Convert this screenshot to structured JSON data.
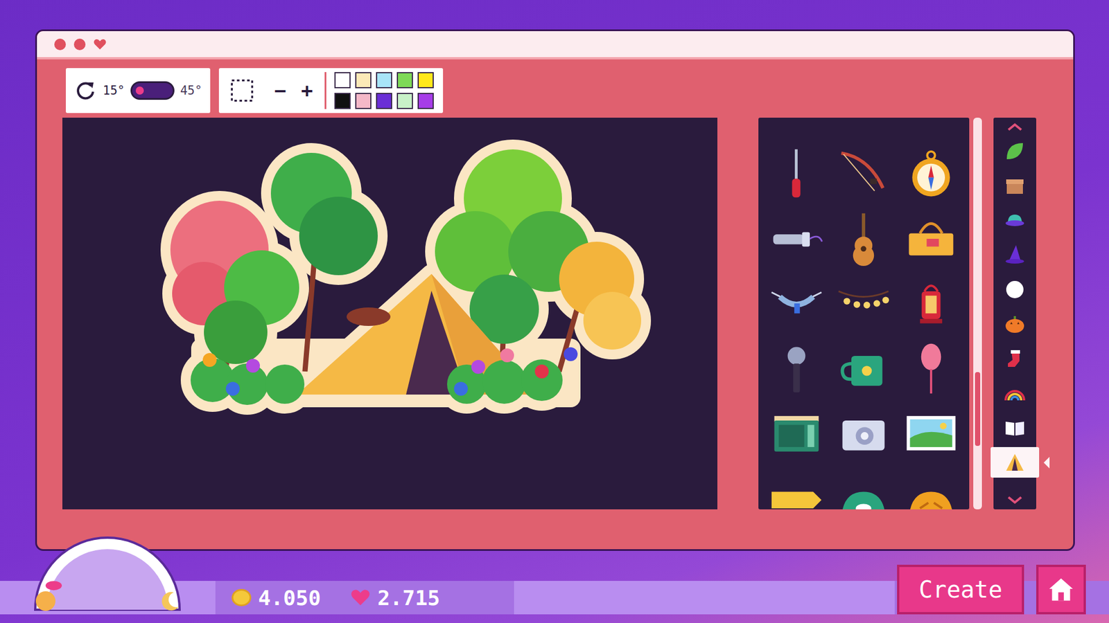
{
  "toolbar": {
    "rotation": [
      {
        "label": "15°",
        "selected": true
      },
      {
        "label": "45°",
        "selected": false
      }
    ],
    "zoom_out": "−",
    "zoom_in": "+",
    "palette": [
      {
        "color": "#ffffff"
      },
      {
        "color": "#fbe9b7"
      },
      {
        "color": "#a8e4f8"
      },
      {
        "color": "#7ed957"
      },
      {
        "color": "#ffe81a"
      },
      {
        "color": "#111111"
      },
      {
        "color": "#f4b8c8"
      },
      {
        "color": "#6a2fd6"
      },
      {
        "color": "#c8f2c8"
      },
      {
        "color": "#a63de8"
      }
    ]
  },
  "items": [
    {
      "kind": "screwdriver"
    },
    {
      "kind": "fishing-rod"
    },
    {
      "kind": "compass"
    },
    {
      "kind": "flashlight"
    },
    {
      "kind": "guitar"
    },
    {
      "kind": "basket"
    },
    {
      "kind": "hammock"
    },
    {
      "kind": "string-lights"
    },
    {
      "kind": "lantern"
    },
    {
      "kind": "microphone"
    },
    {
      "kind": "mug"
    },
    {
      "kind": "net"
    },
    {
      "kind": "radio"
    },
    {
      "kind": "camera"
    },
    {
      "kind": "photo"
    },
    {
      "kind": "sign"
    },
    {
      "kind": "dome"
    },
    {
      "kind": "pie"
    }
  ],
  "item_scroll": {
    "level": 0.8
  },
  "categories": [
    {
      "kind": "leaf",
      "selected": false
    },
    {
      "kind": "box",
      "selected": false
    },
    {
      "kind": "cap",
      "selected": false
    },
    {
      "kind": "witch-hat",
      "selected": false
    },
    {
      "kind": "circle",
      "selected": false
    },
    {
      "kind": "pumpkin",
      "selected": false
    },
    {
      "kind": "stocking",
      "selected": false
    },
    {
      "kind": "rainbow",
      "selected": false
    },
    {
      "kind": "book",
      "selected": false
    },
    {
      "kind": "tent",
      "selected": true
    }
  ],
  "day_meter": {
    "level": 0.12
  },
  "coins": "4.050",
  "hearts": "2.715",
  "create_button": "Create"
}
